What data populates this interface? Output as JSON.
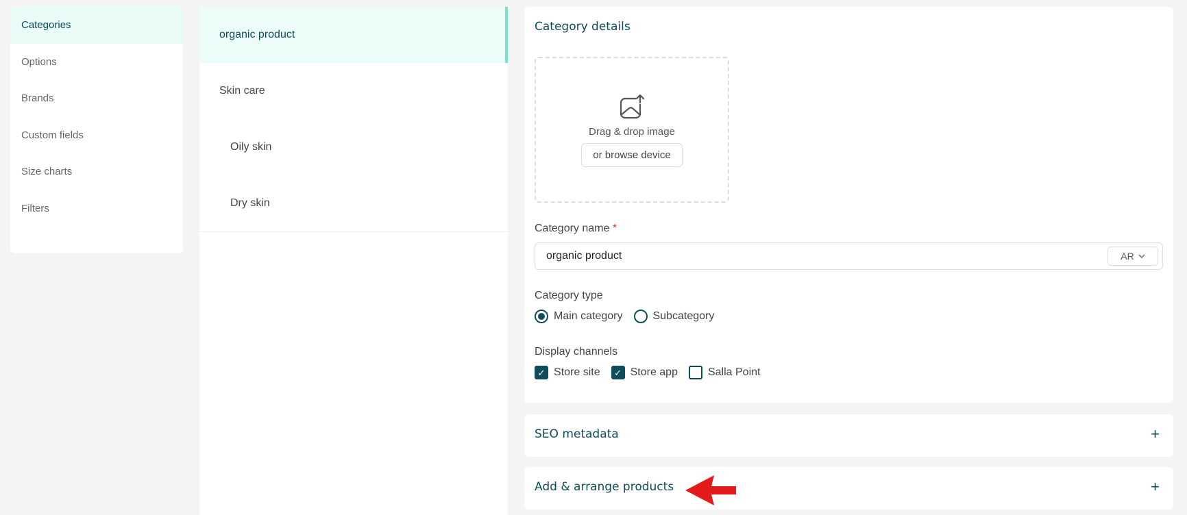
{
  "nav": {
    "items": [
      {
        "label": "Categories"
      },
      {
        "label": "Options"
      },
      {
        "label": "Brands"
      },
      {
        "label": "Custom fields"
      },
      {
        "label": "Size charts"
      },
      {
        "label": "Filters"
      }
    ]
  },
  "categories": [
    {
      "label": "organic product"
    },
    {
      "label": "Skin care"
    },
    {
      "label": "Oily skin"
    },
    {
      "label": "Dry skin"
    }
  ],
  "details": {
    "title": "Category details",
    "upload": {
      "drag_text": "Drag & drop image",
      "browse_label": "or browse device"
    },
    "name_label": "Category name",
    "required_mark": "*",
    "name_value": "organic product",
    "lang_value": "AR",
    "type_label": "Category type",
    "type_options": [
      {
        "label": "Main category",
        "selected": true
      },
      {
        "label": "Subcategory",
        "selected": false
      }
    ],
    "channels_label": "Display channels",
    "channels": [
      {
        "label": "Store site",
        "checked": true
      },
      {
        "label": "Store app",
        "checked": true
      },
      {
        "label": "Salla Point",
        "checked": false
      }
    ]
  },
  "seo": {
    "title": "SEO metadata",
    "toggle": "+"
  },
  "products": {
    "title": "Add & arrange products",
    "toggle": "+"
  },
  "colors": {
    "accent": "#0e4d5a",
    "highlight": "#76e3cf",
    "annotation": "#e21a1a"
  }
}
